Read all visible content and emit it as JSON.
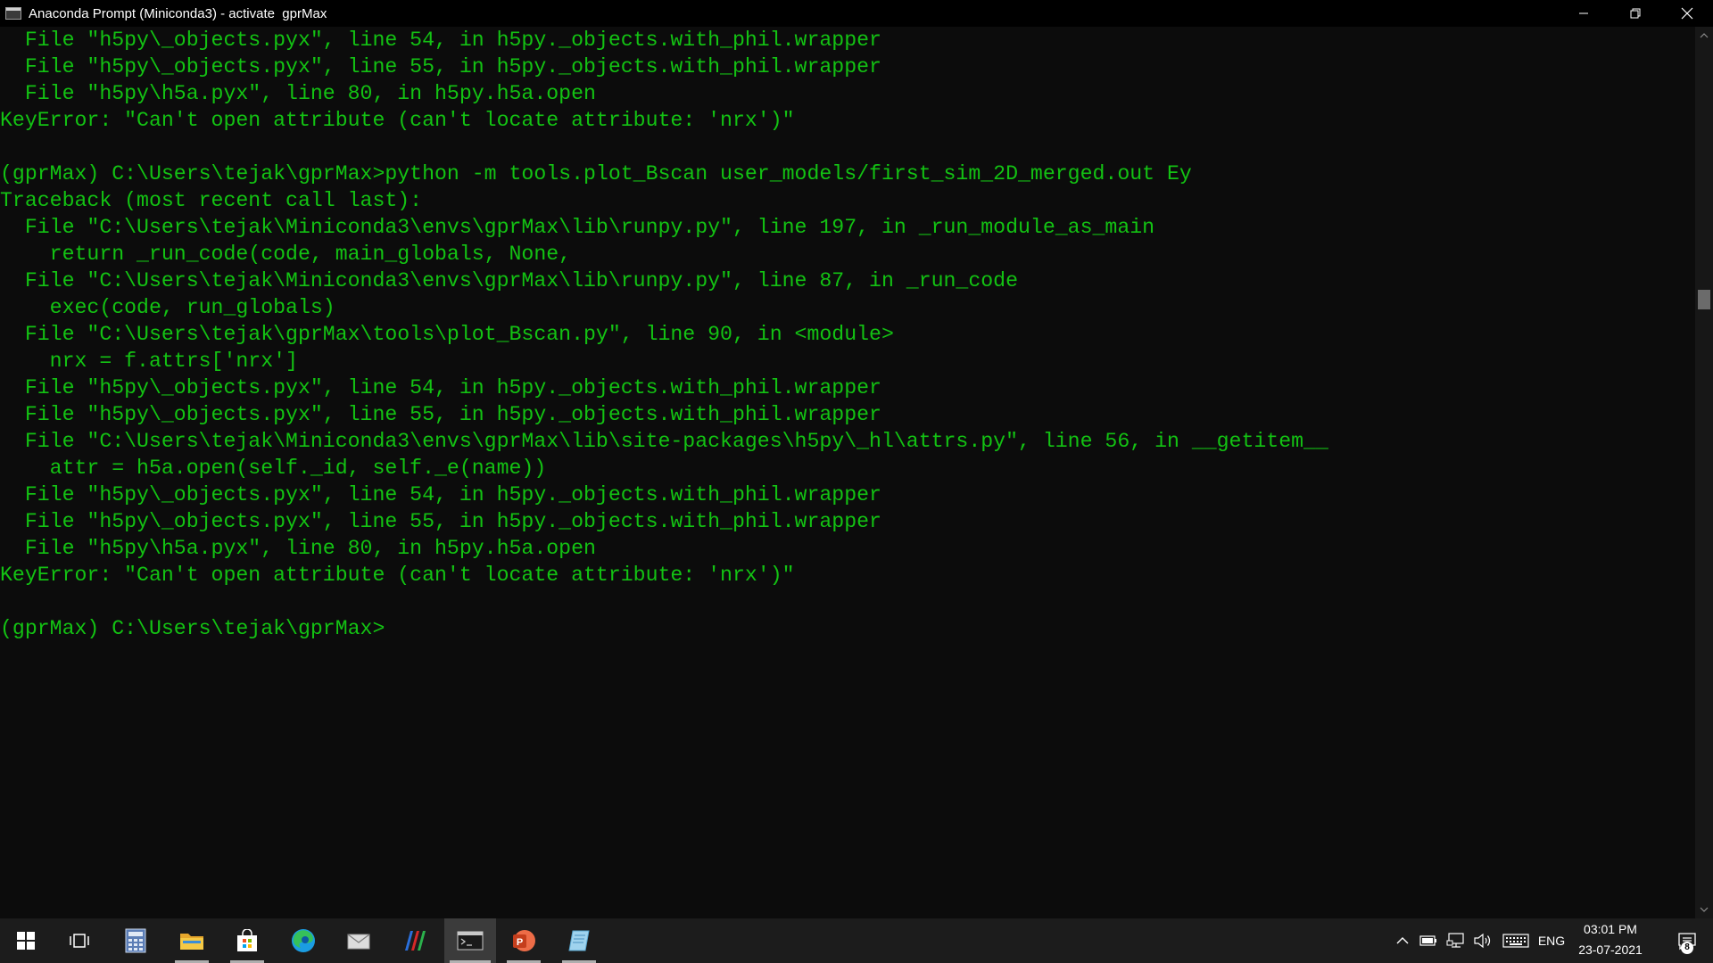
{
  "window": {
    "title": "Anaconda Prompt (Miniconda3) - activate  gprMax",
    "icons": [
      "console-app-icon",
      "minimize-icon",
      "restore-icon",
      "close-icon"
    ]
  },
  "console": {
    "text_color": "#13c213",
    "background": "#0c0c0c",
    "lines": [
      "  File \"h5py\\_objects.pyx\", line 54, in h5py._objects.with_phil.wrapper",
      "  File \"h5py\\_objects.pyx\", line 55, in h5py._objects.with_phil.wrapper",
      "  File \"h5py\\h5a.pyx\", line 80, in h5py.h5a.open",
      "KeyError: \"Can't open attribute (can't locate attribute: 'nrx')\"",
      "",
      "(gprMax) C:\\Users\\tejak\\gprMax>python -m tools.plot_Bscan user_models/first_sim_2D_merged.out Ey",
      "Traceback (most recent call last):",
      "  File \"C:\\Users\\tejak\\Miniconda3\\envs\\gprMax\\lib\\runpy.py\", line 197, in _run_module_as_main",
      "    return _run_code(code, main_globals, None,",
      "  File \"C:\\Users\\tejak\\Miniconda3\\envs\\gprMax\\lib\\runpy.py\", line 87, in _run_code",
      "    exec(code, run_globals)",
      "  File \"C:\\Users\\tejak\\gprMax\\tools\\plot_Bscan.py\", line 90, in <module>",
      "    nrx = f.attrs['nrx']",
      "  File \"h5py\\_objects.pyx\", line 54, in h5py._objects.with_phil.wrapper",
      "  File \"h5py\\_objects.pyx\", line 55, in h5py._objects.with_phil.wrapper",
      "  File \"C:\\Users\\tejak\\Miniconda3\\envs\\gprMax\\lib\\site-packages\\h5py\\_hl\\attrs.py\", line 56, in __getitem__",
      "    attr = h5a.open(self._id, self._e(name))",
      "  File \"h5py\\_objects.pyx\", line 54, in h5py._objects.with_phil.wrapper",
      "  File \"h5py\\_objects.pyx\", line 55, in h5py._objects.with_phil.wrapper",
      "  File \"h5py\\h5a.pyx\", line 80, in h5py.h5a.open",
      "KeyError: \"Can't open attribute (can't locate attribute: 'nrx')\"",
      "",
      "(gprMax) C:\\Users\\tejak\\gprMax>"
    ]
  },
  "taskbar": {
    "apps": [
      {
        "name": "start-button",
        "icon": "windows-logo-icon"
      },
      {
        "name": "task-view-button",
        "icon": "task-view-icon"
      },
      {
        "name": "calculator-button",
        "icon": "calculator-icon"
      },
      {
        "name": "file-explorer-button",
        "icon": "folder-icon"
      },
      {
        "name": "microsoft-store-button",
        "icon": "store-bag-icon"
      },
      {
        "name": "edge-button",
        "icon": "edge-icon"
      },
      {
        "name": "mail-app-button",
        "icon": "envelope-icon"
      },
      {
        "name": "matlab-like-app-button",
        "icon": "colored-bars-icon"
      },
      {
        "name": "anaconda-prompt-button",
        "icon": "terminal-icon",
        "active": true
      },
      {
        "name": "powerpoint-button",
        "icon": "powerpoint-icon"
      },
      {
        "name": "notepad-like-app-button",
        "icon": "notebook-icon"
      }
    ],
    "tray": {
      "language": "ENG",
      "time": "03:01 PM",
      "date": "23-07-2021",
      "notification_count": "8",
      "icons": [
        "chevron-up-icon",
        "battery-icon",
        "network-icon",
        "volume-icon",
        "keyboard-icon",
        "notification-icon"
      ]
    }
  }
}
